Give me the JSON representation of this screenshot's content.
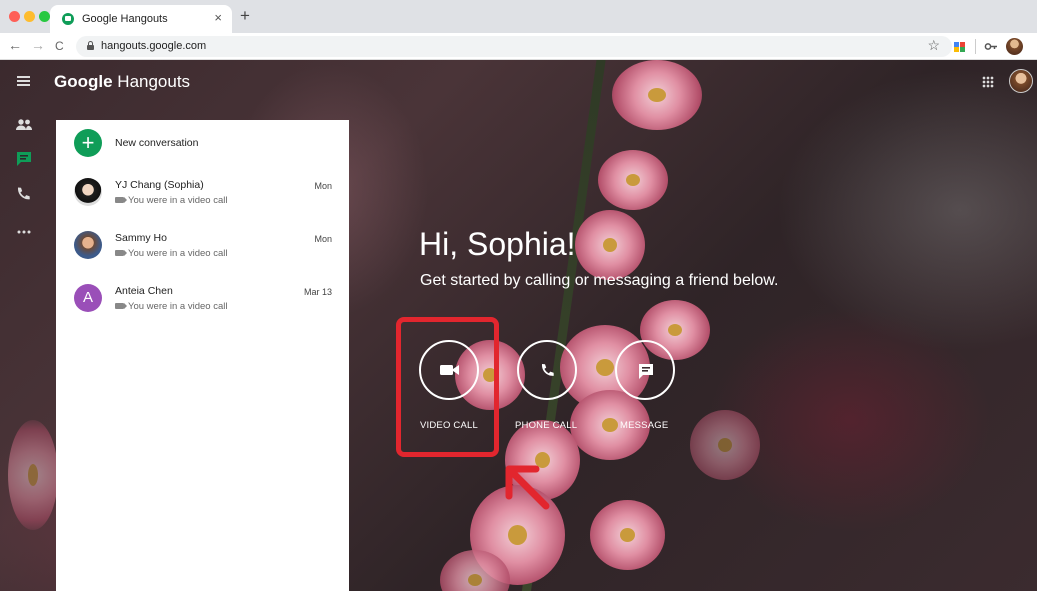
{
  "browser": {
    "tab_title": "Google Hangouts",
    "tab_close": "×",
    "new_tab": "+",
    "url": "hangouts.google.com",
    "back": "←",
    "forward": "→",
    "reload": "C",
    "star": "☆"
  },
  "app": {
    "title_bold": "Google",
    "title_rest": " Hangouts",
    "new_conversation_label": "New conversation",
    "new_conversation_icon": "+",
    "conversations": [
      {
        "name": "YJ Chang (Sophia)",
        "date": "Mon",
        "subtitle": "You were in a video call",
        "avatar_letter": ""
      },
      {
        "name": "Sammy Ho",
        "date": "Mon",
        "subtitle": "You were in a video call",
        "avatar_letter": ""
      },
      {
        "name": "Anteia Chen",
        "date": "Mar 13",
        "subtitle": "You were in a video call",
        "avatar_letter": "A"
      }
    ],
    "greeting": "Hi, Sophia!",
    "subtitle": "Get started by calling or messaging a friend below.",
    "actions": [
      {
        "label": "VIDEO CALL",
        "icon": "video-camera-icon"
      },
      {
        "label": "PHONE CALL",
        "icon": "phone-icon"
      },
      {
        "label": "MESSAGE",
        "icon": "message-icon"
      }
    ]
  },
  "colors": {
    "accent_green": "#0f9d58",
    "highlight_red": "#e2262e",
    "avatar_purple": "#9a4fb8"
  }
}
